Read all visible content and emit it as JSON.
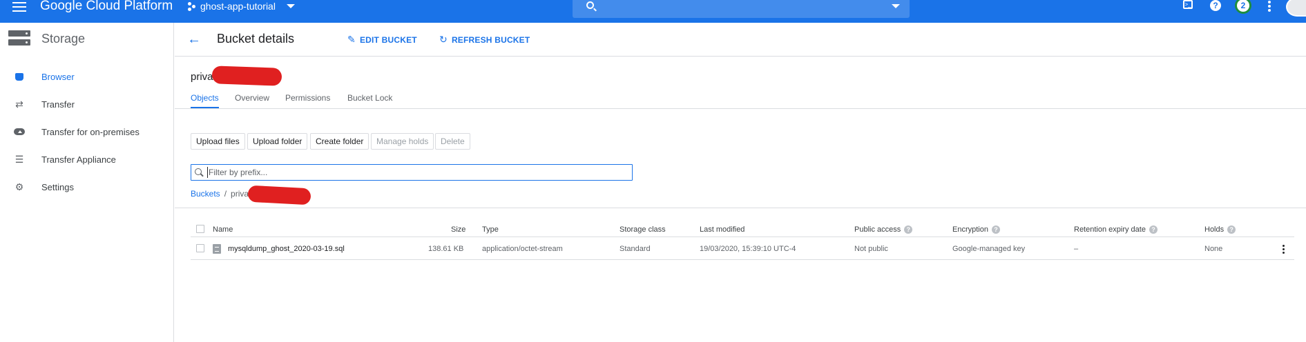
{
  "topbar": {
    "brand": "Google Cloud Platform",
    "project": "ghost-app-tutorial",
    "notification_count": "2",
    "terminal_glyph": ">_",
    "help_glyph": "?"
  },
  "sidebar": {
    "title": "Storage",
    "items": [
      {
        "label": "Browser",
        "icon": "bucket-icon"
      },
      {
        "label": "Transfer",
        "icon": "transfer-arrows-icon"
      },
      {
        "label": "Transfer for on-premises",
        "icon": "cloud-upload-icon"
      },
      {
        "label": "Transfer Appliance",
        "icon": "list-icon"
      },
      {
        "label": "Settings",
        "icon": "gear-icon"
      }
    ]
  },
  "header": {
    "title": "Bucket details",
    "edit_label": "EDIT BUCKET",
    "refresh_label": "REFRESH BUCKET"
  },
  "bucket": {
    "name": "privat",
    "tabs": [
      "Objects",
      "Overview",
      "Permissions",
      "Bucket Lock"
    ]
  },
  "actions": {
    "upload_files": "Upload files",
    "upload_folder": "Upload folder",
    "create_folder": "Create folder",
    "manage_holds": "Manage holds",
    "delete": "Delete"
  },
  "filter": {
    "placeholder": "Filter by prefix..."
  },
  "breadcrumb": {
    "root": "Buckets",
    "separator": "/",
    "current": "priva"
  },
  "table": {
    "columns": [
      "Name",
      "Size",
      "Type",
      "Storage class",
      "Last modified",
      "Public access",
      "Encryption",
      "Retention expiry date",
      "Holds"
    ],
    "rows": [
      {
        "name": "mysqldump_ghost_2020-03-19.sql",
        "size": "138.61 KB",
        "type": "application/octet-stream",
        "storage_class": "Standard",
        "last_modified": "19/03/2020, 15:39:10 UTC-4",
        "public_access": "Not public",
        "encryption": "Google-managed key",
        "retention": "–",
        "holds": "None"
      }
    ]
  },
  "colors": {
    "brand_blue": "#1a73e8",
    "redaction": "#e02020"
  }
}
